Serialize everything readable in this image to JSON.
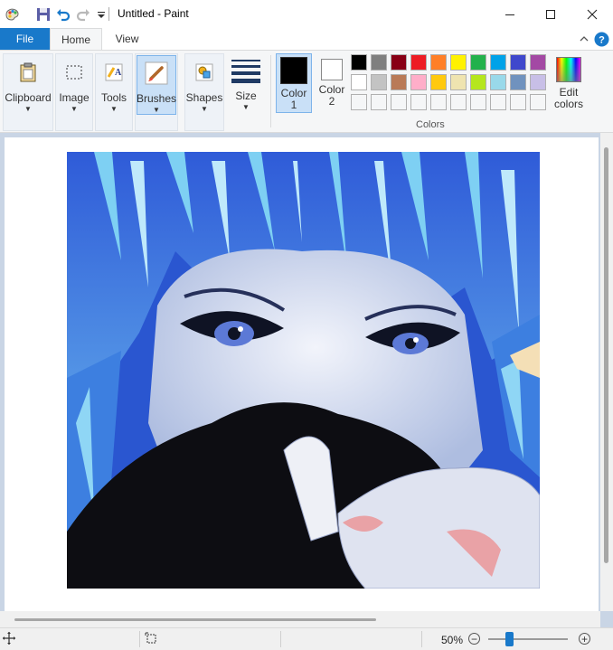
{
  "window": {
    "title": "Untitled - Paint",
    "controls": {
      "minimize_icon": "minimize-icon",
      "maximize_icon": "maximize-icon",
      "close_icon": "close-icon"
    }
  },
  "quick_access": [
    "paint-app-icon",
    "save-icon",
    "undo-icon",
    "redo-icon",
    "customize-dropdown-icon"
  ],
  "tabs": {
    "file": "File",
    "home": "Home",
    "view": "View"
  },
  "ribbon": {
    "tools": [
      {
        "label": "Clipboard",
        "icon": "clipboard-icon"
      },
      {
        "label": "Image",
        "icon": "select-icon"
      },
      {
        "label": "Tools",
        "icon": "tools-icon"
      },
      {
        "label": "Brushes",
        "icon": "brush-icon",
        "active": true
      },
      {
        "label": "Shapes",
        "icon": "shapes-icon"
      },
      {
        "label": "Size",
        "icon": "size-icon"
      }
    ],
    "color1": {
      "label_line1": "Color",
      "label_line2": "1",
      "color": "#000000"
    },
    "color2": {
      "label_line1": "Color",
      "label_line2": "2",
      "color": "#ffffff"
    },
    "colors_label": "Colors",
    "edit_colors": {
      "line1": "Edit",
      "line2": "colors"
    },
    "palette_row1": [
      "#000000",
      "#7f7f7f",
      "#880015",
      "#ed1c24",
      "#ff7f27",
      "#fff200",
      "#22b14c",
      "#00a2e8",
      "#3f48cc",
      "#a349a4"
    ],
    "palette_row2": [
      "#ffffff",
      "#c3c3c3",
      "#b97a57",
      "#ffaec9",
      "#ffc90e",
      "#efe4b0",
      "#b5e61d",
      "#99d9ea",
      "#7092be",
      "#c8bfe7"
    ],
    "palette_row3": [
      "#f5f6f7",
      "#f5f6f7",
      "#f5f6f7",
      "#f5f6f7",
      "#f5f6f7",
      "#f5f6f7",
      "#f5f6f7",
      "#f5f6f7",
      "#f5f6f7",
      "#f5f6f7"
    ]
  },
  "status": {
    "zoom": "50%",
    "zoom_level": 0.5,
    "icons": [
      "move-cursor-icon",
      "selection-size-icon",
      "zoom-out-icon",
      "zoom-in-icon"
    ]
  },
  "colors": {
    "accent": "#1979ca",
    "ribbon_bg": "#f5f6f7",
    "workspace_bg": "#c9d5e5"
  }
}
